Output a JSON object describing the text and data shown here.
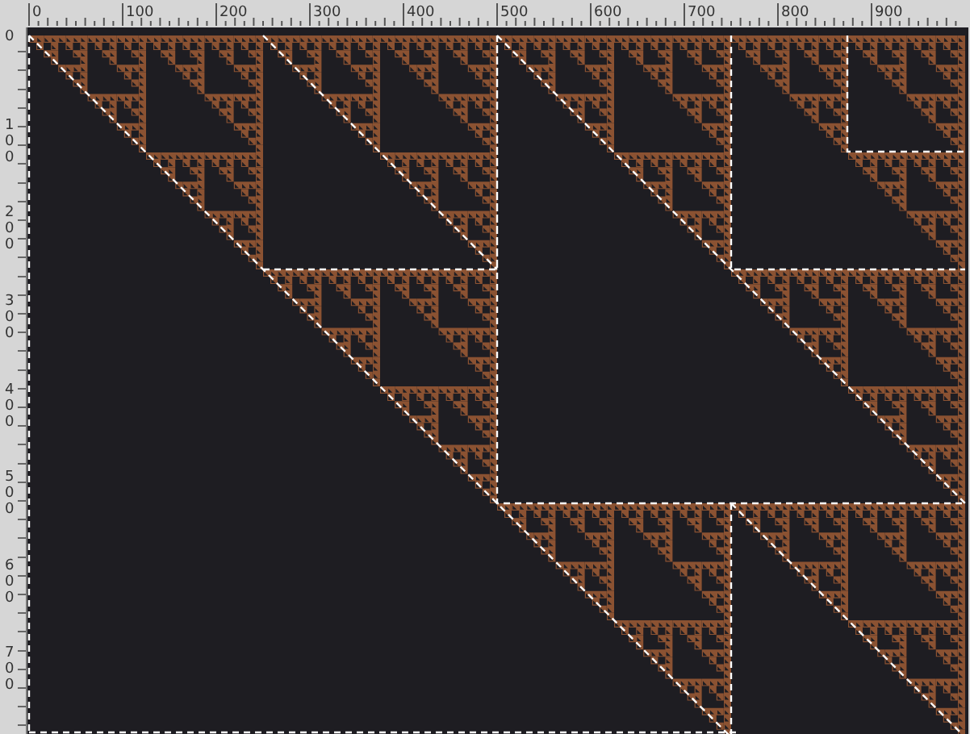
{
  "top_ruler": {
    "labels": [
      "0",
      "100",
      "200",
      "300",
      "400",
      "500",
      "600",
      "700",
      "800",
      "900"
    ]
  },
  "left_ruler": {
    "labels": [
      "0",
      "100",
      "200",
      "300",
      "400",
      "500",
      "600",
      "700"
    ]
  }
}
